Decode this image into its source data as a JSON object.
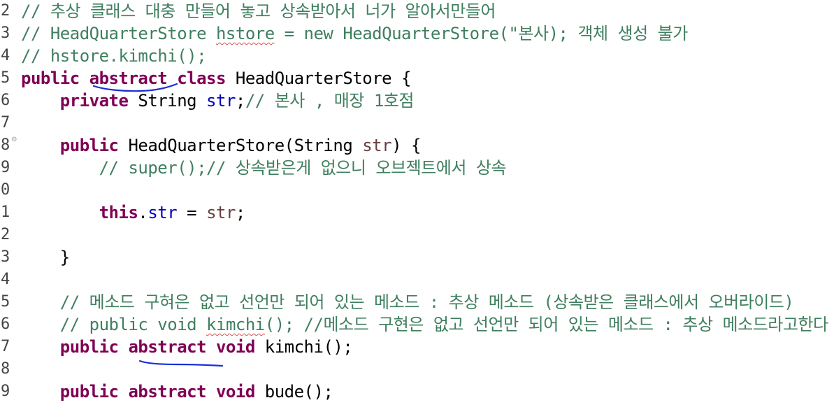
{
  "editor": {
    "lines": [
      {
        "num": "2",
        "fold": false,
        "indent": "",
        "tokens": [
          {
            "text": "// 추상 클래스 대충 만들어 놓고 상속받아서 너가 알아서만들어",
            "kind": "comment"
          }
        ]
      },
      {
        "num": "3",
        "fold": false,
        "indent": "",
        "tokens": [
          {
            "text": "// HeadQuarterStore ",
            "kind": "comment"
          },
          {
            "text": "hstore",
            "kind": "comment",
            "squiggle": true
          },
          {
            "text": " = new HeadQuarterStore(\"본사); 객체 생성 불가",
            "kind": "comment"
          }
        ]
      },
      {
        "num": "4",
        "fold": false,
        "indent": "",
        "tokens": [
          {
            "text": "// hstore.kimchi();",
            "kind": "comment"
          }
        ]
      },
      {
        "num": "5",
        "fold": false,
        "indent": "",
        "tokens": [
          {
            "text": "public",
            "kind": "kw"
          },
          {
            "text": " ",
            "kind": "plain"
          },
          {
            "text": "abstract",
            "kind": "kw"
          },
          {
            "text": " ",
            "kind": "plain"
          },
          {
            "text": "class",
            "kind": "kw"
          },
          {
            "text": " HeadQuarterStore {",
            "kind": "plain"
          }
        ]
      },
      {
        "num": "6",
        "fold": false,
        "indent": "    ",
        "tokens": [
          {
            "text": "private",
            "kind": "kw"
          },
          {
            "text": " String ",
            "kind": "plain"
          },
          {
            "text": "str",
            "kind": "field"
          },
          {
            "text": ";",
            "kind": "plain"
          },
          {
            "text": "// 본사 , 매장 1호점",
            "kind": "comment"
          }
        ]
      },
      {
        "num": "7",
        "fold": false,
        "indent": "",
        "tokens": []
      },
      {
        "num": "8",
        "fold": true,
        "indent": "    ",
        "tokens": [
          {
            "text": "public",
            "kind": "kw"
          },
          {
            "text": " HeadQuarterStore(String ",
            "kind": "plain"
          },
          {
            "text": "str",
            "kind": "param"
          },
          {
            "text": ") {",
            "kind": "plain"
          }
        ]
      },
      {
        "num": "9",
        "fold": false,
        "indent": "        ",
        "tokens": [
          {
            "text": "// super();// 상속받은게 없으니 오브젝트에서 상속",
            "kind": "comment"
          }
        ]
      },
      {
        "num": "0",
        "fold": false,
        "indent": "",
        "tokens": []
      },
      {
        "num": "1",
        "fold": false,
        "indent": "        ",
        "tokens": [
          {
            "text": "this",
            "kind": "kw"
          },
          {
            "text": ".",
            "kind": "plain"
          },
          {
            "text": "str",
            "kind": "field"
          },
          {
            "text": " = ",
            "kind": "plain"
          },
          {
            "text": "str",
            "kind": "param"
          },
          {
            "text": ";",
            "kind": "plain"
          }
        ]
      },
      {
        "num": "2",
        "fold": false,
        "indent": "",
        "tokens": []
      },
      {
        "num": "3",
        "fold": false,
        "indent": "    ",
        "tokens": [
          {
            "text": "}",
            "kind": "plain"
          }
        ]
      },
      {
        "num": "4",
        "fold": false,
        "indent": "",
        "tokens": []
      },
      {
        "num": "5",
        "fold": false,
        "indent": "    ",
        "tokens": [
          {
            "text": "// 메소드 구혀은 없고 선언만 되어 있는 메소드 : 추상 메소드 (상속받은 클래스에서 오버라이드)",
            "kind": "comment"
          }
        ]
      },
      {
        "num": "6",
        "fold": false,
        "indent": "    ",
        "tokens": [
          {
            "text": "// public void ",
            "kind": "comment"
          },
          {
            "text": "kimchi",
            "kind": "comment",
            "squiggle": true
          },
          {
            "text": "(); //메소드 구현은 없고 선언만 되어 있는 메소드 : 추상 메소드라고한다",
            "kind": "comment"
          }
        ]
      },
      {
        "num": "7",
        "fold": false,
        "indent": "    ",
        "tokens": [
          {
            "text": "public",
            "kind": "kw"
          },
          {
            "text": " ",
            "kind": "plain"
          },
          {
            "text": "abstract",
            "kind": "kw"
          },
          {
            "text": " ",
            "kind": "plain"
          },
          {
            "text": "void",
            "kind": "kw"
          },
          {
            "text": " kimchi();",
            "kind": "plain"
          }
        ]
      },
      {
        "num": "8",
        "fold": false,
        "indent": "",
        "tokens": []
      },
      {
        "num": "9",
        "fold": false,
        "indent": "    ",
        "tokens": [
          {
            "text": "public",
            "kind": "kw"
          },
          {
            "text": " ",
            "kind": "plain"
          },
          {
            "text": "abstract",
            "kind": "kw"
          },
          {
            "text": " ",
            "kind": "plain"
          },
          {
            "text": "void",
            "kind": "kw"
          },
          {
            "text": " bude();",
            "kind": "plain"
          }
        ]
      }
    ],
    "fold_icon": "collapse-minus-icon",
    "colors": {
      "comment": "#3f7f5f",
      "keyword": "#7f0055",
      "field": "#0000c0",
      "parameter": "#6a3e3e",
      "annotation_ink": "#1a2fd6"
    }
  }
}
